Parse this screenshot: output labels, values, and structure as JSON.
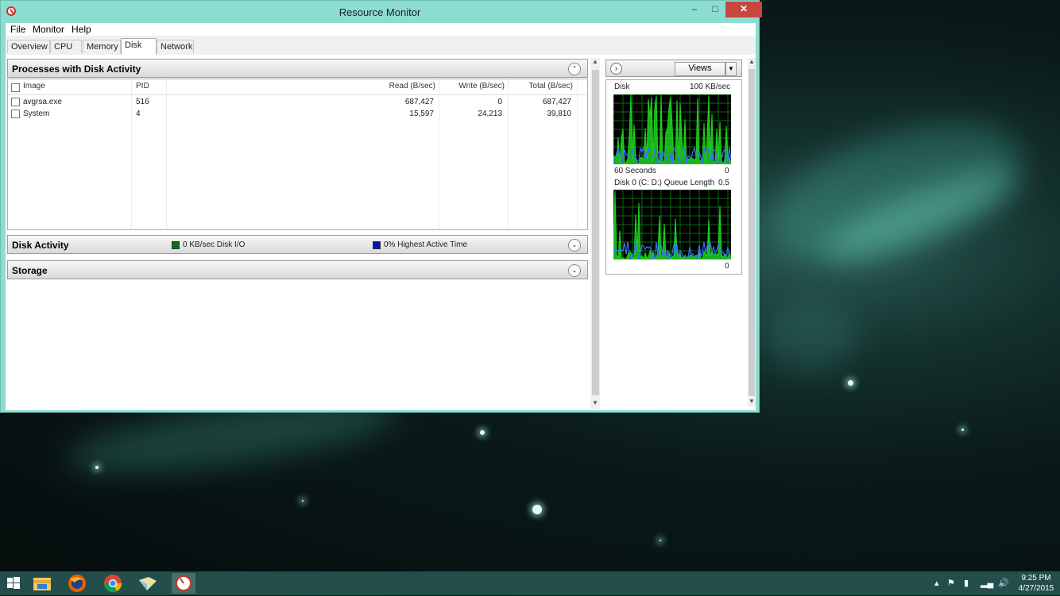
{
  "window": {
    "title": "Resource Monitor",
    "minimize": "–",
    "maximize": "□",
    "close": "✕"
  },
  "menu": [
    "File",
    "Monitor",
    "Help"
  ],
  "tabs": [
    {
      "label": "Overview",
      "active": false
    },
    {
      "label": "CPU",
      "active": false
    },
    {
      "label": "Memory",
      "active": false
    },
    {
      "label": "Disk",
      "active": true
    },
    {
      "label": "Network",
      "active": false
    }
  ],
  "processes": {
    "title": "Processes with Disk Activity",
    "columns": [
      "Image",
      "PID",
      "Read (B/sec)",
      "Write (B/sec)",
      "Total (B/sec)"
    ],
    "rows": [
      {
        "image": "avgrsa.exe",
        "pid": "516",
        "read": "687,427",
        "write": "0",
        "total": "687,427"
      },
      {
        "image": "System",
        "pid": "4",
        "read": "15,597",
        "write": "24,213",
        "total": "39,810"
      }
    ]
  },
  "disk_activity": {
    "title": "Disk Activity",
    "io_legend": "0 KB/sec Disk I/O",
    "active_legend": "0% Highest Active Time",
    "io_color": "#0b6e1d",
    "active_color": "#0015b8"
  },
  "storage": {
    "title": "Storage"
  },
  "right_panel": {
    "views_label": "Views",
    "graph1": {
      "title": "Disk",
      "scale": "100 KB/sec",
      "footer_left": "60 Seconds",
      "footer_right": "0"
    },
    "graph2": {
      "title": "Disk 0 (C: D:) Queue Length",
      "scale": "0.5",
      "footer_right": "0"
    }
  },
  "taskbar": {
    "apps": [
      "start-icon",
      "file-explorer-icon",
      "firefox-icon",
      "chrome-icon",
      "folder-app-icon",
      "resource-monitor-icon"
    ],
    "time": "9:25 PM",
    "date": "4/27/2015"
  },
  "colors": {
    "window_frame": "#8ddcd0",
    "graph_green": "#1fd11f",
    "graph_blue": "#3a6bff",
    "grid": "#0a6b0a"
  }
}
